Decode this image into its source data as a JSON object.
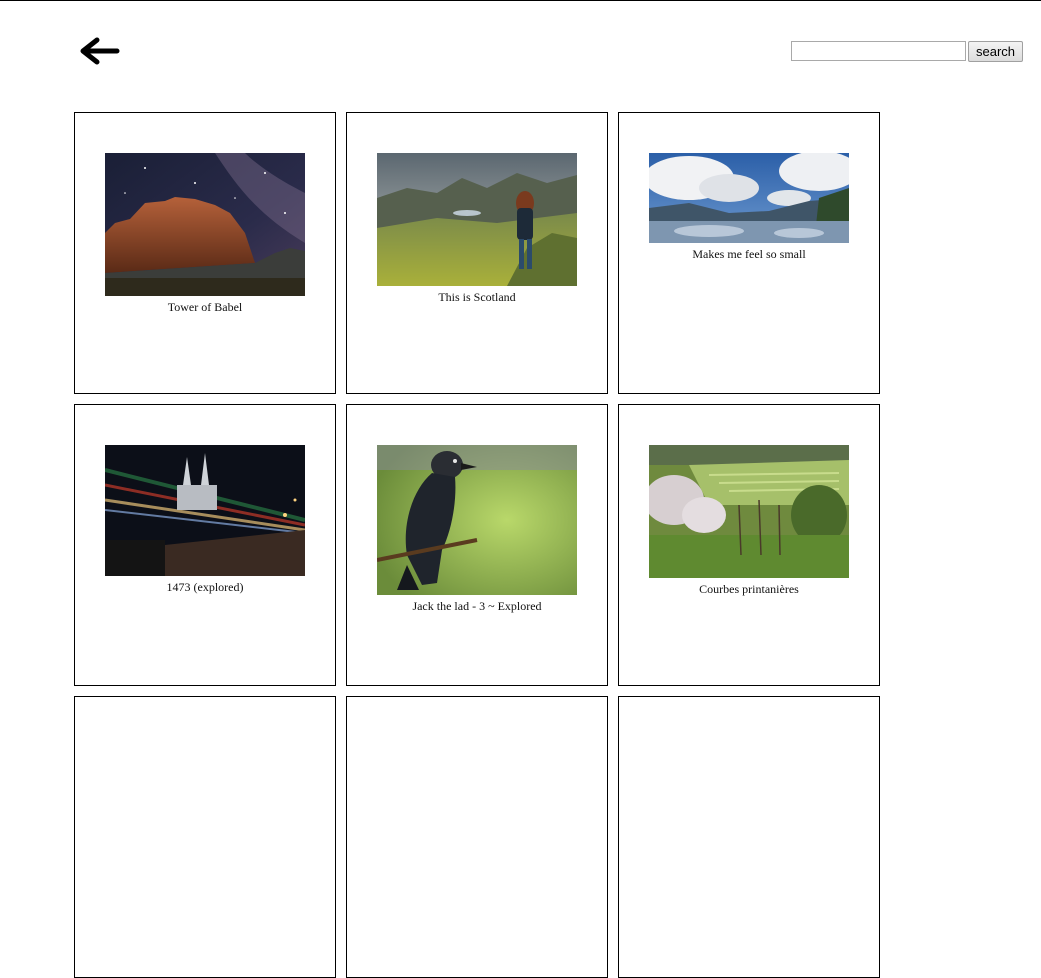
{
  "header": {
    "back_icon": "arrow-left-icon",
    "search_placeholder": "",
    "search_value": "",
    "search_button_label": "search"
  },
  "gallery": {
    "items": [
      {
        "title": "Tower of Babel"
      },
      {
        "title": "This is Scotland"
      },
      {
        "title": "Makes me feel so small"
      },
      {
        "title": "1473 (explored)"
      },
      {
        "title": "Jack the lad - 3 ~ Explored"
      },
      {
        "title": "Courbes printanières"
      }
    ]
  }
}
